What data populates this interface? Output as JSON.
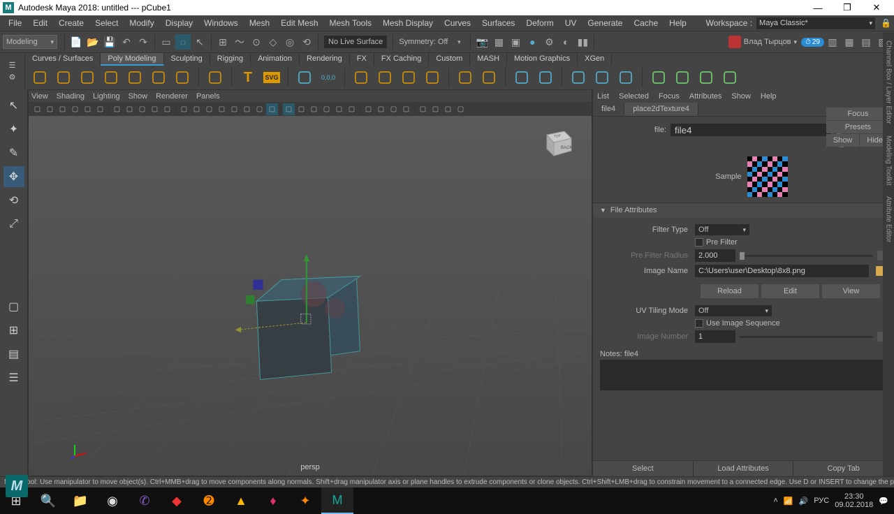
{
  "window": {
    "title": "Autodesk Maya 2018: untitled  ---  pCube1",
    "app_icon_letter": "M"
  },
  "menubar": {
    "items": [
      "File",
      "Edit",
      "Create",
      "Select",
      "Modify",
      "Display",
      "Windows",
      "Mesh",
      "Edit Mesh",
      "Mesh Tools",
      "Mesh Display",
      "Curves",
      "Surfaces",
      "Deform",
      "UV",
      "Generate",
      "Cache",
      "Help"
    ],
    "workspace_label": "Workspace :",
    "workspace_value": "Maya Classic*"
  },
  "toolbar": {
    "mode": "Modeling",
    "live_surface": "No Live Surface",
    "symmetry_label": "Symmetry:",
    "symmetry_value": "Off",
    "user_name": "Влад Тырцов",
    "badge_value": "29"
  },
  "shelf": {
    "tabs": [
      "Curves / Surfaces",
      "Poly Modeling",
      "Sculpting",
      "Rigging",
      "Animation",
      "Rendering",
      "FX",
      "FX Caching",
      "Custom",
      "MASH",
      "Motion Graphics",
      "XGen"
    ],
    "active_tab": 1
  },
  "viewport": {
    "menus": [
      "View",
      "Shading",
      "Lighting",
      "Show",
      "Renderer",
      "Panels"
    ],
    "camera_label": "persp",
    "viewcube_face": "BACK",
    "viewcube_top": "TOP"
  },
  "attr": {
    "menus": [
      "List",
      "Selected",
      "Focus",
      "Attributes",
      "Show",
      "Help"
    ],
    "tabs": [
      "file4",
      "place2dTexture4"
    ],
    "file_label": "file:",
    "file_value": "file4",
    "side_buttons": {
      "focus": "Focus",
      "presets": "Presets",
      "show": "Show",
      "hide": "Hide"
    },
    "sample_label": "Sample",
    "section_title": "File Attributes",
    "filter_type_label": "Filter Type",
    "filter_type_value": "Off",
    "pre_filter_label": "Pre Filter",
    "pre_filter_radius_label": "Pre Filter Radius",
    "pre_filter_radius_value": "2.000",
    "image_name_label": "Image Name",
    "image_name_value": "C:\\Users\\user\\Desktop\\8x8.png",
    "reload_btn": "Reload",
    "edit_btn": "Edit",
    "view_btn": "View",
    "uv_tiling_label": "UV Tiling Mode",
    "uv_tiling_value": "Off",
    "use_seq_label": "Use Image Sequence",
    "image_number_label": "Image Number",
    "image_number_value": "1",
    "notes_label": "Notes:",
    "notes_target": "file4",
    "footer": {
      "select": "Select",
      "load": "Load Attributes",
      "copy": "Copy Tab"
    }
  },
  "vtabs": [
    "Channel Box / Layer Editor",
    "Modeling Toolkit",
    "Attribute Editor"
  ],
  "statusbar": "Move Tool: Use manipulator to move object(s). Ctrl+MMB+drag to move components along normals. Shift+drag manipulator axis or plane handles to extrude components or clone objects. Ctrl+Shift+LMB+drag to constrain movement to a connected edge. Use D or INSERT to change the pivot position a",
  "taskbar": {
    "lang": "РУС",
    "time": "23:30",
    "date": "09.02.2018"
  }
}
